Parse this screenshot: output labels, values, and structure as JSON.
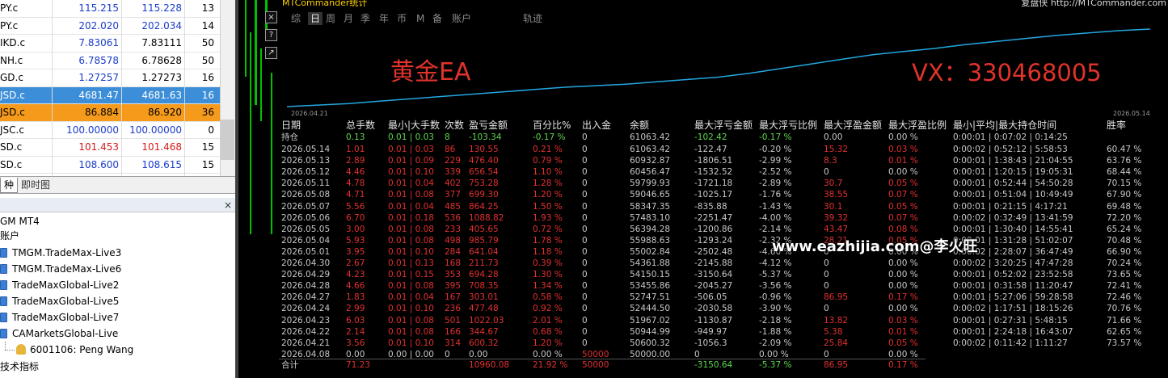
{
  "market_watch": {
    "rows": [
      {
        "symbol": "PY.c",
        "bid": "115.215",
        "ask": "115.228",
        "spread": "13",
        "bid_color": "#1a3cc8",
        "ask_color": "#1a3cc8",
        "bg": ""
      },
      {
        "symbol": "PY.c",
        "bid": "202.020",
        "ask": "202.034",
        "spread": "14",
        "bid_color": "#1a3cc8",
        "ask_color": "#1a3cc8",
        "bg": ""
      },
      {
        "symbol": "IKD.c",
        "bid": "7.83061",
        "ask": "7.83111",
        "spread": "50",
        "bid_color": "#1a3cc8",
        "ask_color": "#000000",
        "bg": ""
      },
      {
        "symbol": "NH.c",
        "bid": "6.78578",
        "ask": "6.78628",
        "spread": "50",
        "bid_color": "#1a3cc8",
        "ask_color": "#000000",
        "bg": ""
      },
      {
        "symbol": "GD.c",
        "bid": "1.27257",
        "ask": "1.27273",
        "spread": "16",
        "bid_color": "#1a3cc8",
        "ask_color": "#000000",
        "bg": ""
      },
      {
        "symbol": "JSD.c",
        "bid": "4681.47",
        "ask": "4681.63",
        "spread": "16",
        "bid_color": "#ffffff",
        "ask_color": "#ffffff",
        "bg": "#3c8ed8"
      },
      {
        "symbol": "JSD.c",
        "bid": "86.884",
        "ask": "86.920",
        "spread": "36",
        "bid_color": "#000000",
        "ask_color": "#000000",
        "bg": "#f59a1b"
      },
      {
        "symbol": "JSC.c",
        "bid": "100.00000",
        "ask": "100.00000",
        "spread": "0",
        "bid_color": "#1a3cc8",
        "ask_color": "#1a3cc8",
        "bg": ""
      },
      {
        "symbol": "SD.c",
        "bid": "101.453",
        "ask": "101.468",
        "spread": "15",
        "bid_color": "#d81818",
        "ask_color": "#d81818",
        "bg": ""
      },
      {
        "symbol": "SD.c",
        "bid": "108.600",
        "ask": "108.615",
        "spread": "15",
        "bid_color": "#1a3cc8",
        "ask_color": "#1a3cc8",
        "bg": ""
      }
    ],
    "tabs": [
      "种",
      "即时图"
    ]
  },
  "navigator": {
    "root": "GM MT4",
    "accounts_label": "账户",
    "accounts": [
      "TMGM.TradeMax-Live3",
      "TMGM.TradeMax-Live6",
      "TradeMaxGlobal-Live2",
      "TradeMaxGlobal-Live5",
      "TradeMaxGlobal-Live7",
      "CAMarketsGlobal-Live"
    ],
    "login": "6001106: Peng Wang",
    "indicators_label": "技术指标",
    "close_glyph": "×"
  },
  "stats_window": {
    "title": "MTCommander统计",
    "brand": "复盘侠 http://MTCommander.com",
    "toolbar": [
      "综",
      "日",
      "周",
      "月",
      "季",
      "年",
      "币",
      "M",
      "备",
      "账户",
      "轨迹"
    ],
    "active_tab": "日",
    "watermark_left": "黄金EA",
    "watermark_right": "VX：330468005",
    "overlay_text": "www.eazhijia.com@李火旺",
    "equity": {
      "start_label": "2026.04.21",
      "end_label": "2026.05.14",
      "line_color": "#23a7e0",
      "curve": [
        0,
        2,
        4,
        7,
        10,
        13,
        16,
        19,
        22,
        25,
        27,
        29,
        32,
        35,
        38,
        43,
        49,
        55,
        61,
        67,
        71,
        75,
        80,
        84,
        88,
        92,
        95,
        98,
        100
      ]
    },
    "headers": [
      "日期",
      "总手数",
      "最小|大手数",
      "次数",
      "盈亏金额",
      "百分比%",
      "出入金",
      "余额",
      "最大浮亏金额",
      "最大浮亏比例",
      "最大浮盈金额",
      "最大浮盈比例",
      "最小|平均|最大持仓时间",
      "胜率"
    ],
    "holding": {
      "label": "持仓",
      "lots": "0.13",
      "minmax": "0.01 | 0.03",
      "count": "8",
      "pnl": "-103.34",
      "pct": "-0.17 %",
      "io": "0",
      "balance": "61063.42",
      "fl": "-102.42",
      "flp": "-0.17 %",
      "fp": "0.00",
      "fpp": "0.00 %",
      "time": "0:00:01 | 0:07:02 | 0:14:25",
      "win": ""
    },
    "rows": [
      {
        "d": "2026.05.14",
        "lots": "1.01",
        "mm": "0.01 | 0.03",
        "n": "86",
        "pnl": "130.55",
        "pct": "0.21 %",
        "io": "0",
        "bal": "61063.42",
        "fl": "-122.47",
        "flp": "-0.20 %",
        "fp": "15.32",
        "fpp": "0.03 %",
        "time": "0:00:02 | 0:52:12 | 5:58:53",
        "win": "60.47 %"
      },
      {
        "d": "2026.05.13",
        "lots": "2.89",
        "mm": "0.01 | 0.09",
        "n": "229",
        "pnl": "476.40",
        "pct": "0.79 %",
        "io": "0",
        "bal": "60932.87",
        "fl": "-1806.51",
        "flp": "-2.99 %",
        "fp": "8.3",
        "fpp": "0.01 %",
        "time": "0:00:01 | 1:38:43 | 21:04:55",
        "win": "63.76 %"
      },
      {
        "d": "2026.05.12",
        "lots": "4.46",
        "mm": "0.01 | 0.10",
        "n": "339",
        "pnl": "656.54",
        "pct": "1.10 %",
        "io": "0",
        "bal": "60456.47",
        "fl": "-1532.52",
        "flp": "-2.52 %",
        "fp": "0",
        "fpp": "0.00 %",
        "time": "0:00:01 | 1:20:15 | 19:05:31",
        "win": "68.44 %"
      },
      {
        "d": "2026.05.11",
        "lots": "4.78",
        "mm": "0.01 | 0.04",
        "n": "402",
        "pnl": "753.28",
        "pct": "1.28 %",
        "io": "0",
        "bal": "59799.93",
        "fl": "-1721.18",
        "flp": "-2.89 %",
        "fp": "30.7",
        "fpp": "0.05 %",
        "time": "0:00:01 | 0:52:44 | 54:50:28",
        "win": "70.15 %"
      },
      {
        "d": "2026.05.08",
        "lots": "4.71",
        "mm": "0.01 | 0.08",
        "n": "377",
        "pnl": "699.30",
        "pct": "1.20 %",
        "io": "0",
        "bal": "59046.65",
        "fl": "-1025.17",
        "flp": "-1.76 %",
        "fp": "38.55",
        "fpp": "0.07 %",
        "time": "0:00:01 | 0:51:04 | 10:49:49",
        "win": "67.90 %"
      },
      {
        "d": "2026.05.07",
        "lots": "5.56",
        "mm": "0.01 | 0.04",
        "n": "485",
        "pnl": "864.25",
        "pct": "1.50 %",
        "io": "0",
        "bal": "58347.35",
        "fl": "-835.88",
        "flp": "-1.43 %",
        "fp": "30.1",
        "fpp": "0.05 %",
        "time": "0:00:01 | 0:21:15 | 4:17:21",
        "win": "69.48 %"
      },
      {
        "d": "2026.05.06",
        "lots": "6.70",
        "mm": "0.01 | 0.18",
        "n": "536",
        "pnl": "1088.82",
        "pct": "1.93 %",
        "io": "0",
        "bal": "57483.10",
        "fl": "-2251.47",
        "flp": "-4.00 %",
        "fp": "39.32",
        "fpp": "0.07 %",
        "time": "0:00:02 | 0:32:49 | 13:41:59",
        "win": "72.20 %"
      },
      {
        "d": "2026.05.05",
        "lots": "3.00",
        "mm": "0.01 | 0.08",
        "n": "233",
        "pnl": "405.65",
        "pct": "0.72 %",
        "io": "0",
        "bal": "56394.28",
        "fl": "-1200.86",
        "flp": "-2.14 %",
        "fp": "43.47",
        "fpp": "0.08 %",
        "time": "0:00:01 | 1:30:40 | 14:55:41",
        "win": "65.24 %"
      },
      {
        "d": "2026.05.04",
        "lots": "5.93",
        "mm": "0.01 | 0.08",
        "n": "498",
        "pnl": "985.79",
        "pct": "1.78 %",
        "io": "0",
        "bal": "55988.63",
        "fl": "-1293.24",
        "flp": "-2.32 %",
        "fp": "28.21",
        "fpp": "0.05 %",
        "time": "0:00:01 | 1:31:28 | 51:02:07",
        "win": "70.48 %"
      },
      {
        "d": "2026.05.01",
        "lots": "3.95",
        "mm": "0.01 | 0.10",
        "n": "284",
        "pnl": "641.04",
        "pct": "1.18 %",
        "io": "0",
        "bal": "55002.84",
        "fl": "-2502.48",
        "flp": "-4.60 %",
        "fp": "0",
        "fpp": "0.00 %",
        "time": "0:00:02 | 2:28:07 | 36:47:49",
        "win": "66.90 %"
      },
      {
        "d": "2026.04.30",
        "lots": "2.67",
        "mm": "0.01 | 0.13",
        "n": "168",
        "pnl": "211.73",
        "pct": "0.39 %",
        "io": "0",
        "bal": "54361.88",
        "fl": "-2145.88",
        "flp": "-4.12 %",
        "fp": "0",
        "fpp": "0.00 %",
        "time": "0:00:02 | 3:20:25 | 47:47:28",
        "win": "70.24 %"
      },
      {
        "d": "2026.04.29",
        "lots": "4.23",
        "mm": "0.01 | 0.15",
        "n": "353",
        "pnl": "694.28",
        "pct": "1.30 %",
        "io": "0",
        "bal": "54150.15",
        "fl": "-3150.64",
        "flp": "-5.37 %",
        "fp": "0",
        "fpp": "0.00 %",
        "time": "0:00:01 | 0:52:02 | 23:52:58",
        "win": "73.65 %"
      },
      {
        "d": "2026.04.28",
        "lots": "4.66",
        "mm": "0.01 | 0.08",
        "n": "395",
        "pnl": "708.35",
        "pct": "1.34 %",
        "io": "0",
        "bal": "53455.86",
        "fl": "-2045.27",
        "flp": "-3.56 %",
        "fp": "0",
        "fpp": "0.00 %",
        "time": "0:00:01 | 0:31:58 | 11:20:47",
        "win": "72.41 %"
      },
      {
        "d": "2026.04.27",
        "lots": "1.83",
        "mm": "0.01 | 0.04",
        "n": "167",
        "pnl": "303.01",
        "pct": "0.58 %",
        "io": "0",
        "bal": "52747.51",
        "fl": "-506.05",
        "flp": "-0.96 %",
        "fp": "86.95",
        "fpp": "0.17 %",
        "time": "0:00:01 | 5:27:06 | 59:28:58",
        "win": "72.46 %"
      },
      {
        "d": "2026.04.24",
        "lots": "2.99",
        "mm": "0.01 | 0.10",
        "n": "236",
        "pnl": "477.48",
        "pct": "0.92 %",
        "io": "0",
        "bal": "52444.50",
        "fl": "-2030.58",
        "flp": "-3.90 %",
        "fp": "0",
        "fpp": "0.00 %",
        "time": "0:00:02 | 1:17:51 | 18:15:26",
        "win": "70.76 %"
      },
      {
        "d": "2026.04.23",
        "lots": "6.03",
        "mm": "0.01 | 0.08",
        "n": "501",
        "pnl": "1022.03",
        "pct": "2.01 %",
        "io": "0",
        "bal": "51967.02",
        "fl": "-1130.87",
        "flp": "-2.18 %",
        "fp": "13.82",
        "fpp": "0.03 %",
        "time": "0:00:01 | 0:27:31 | 5:48:15",
        "win": "71.66 %"
      },
      {
        "d": "2026.04.22",
        "lots": "2.14",
        "mm": "0.01 | 0.08",
        "n": "166",
        "pnl": "344.67",
        "pct": "0.68 %",
        "io": "0",
        "bal": "50944.99",
        "fl": "-949.97",
        "flp": "-1.88 %",
        "fp": "5.38",
        "fpp": "0.01 %",
        "time": "0:00:01 | 2:24:18 | 16:43:07",
        "win": "62.65 %"
      },
      {
        "d": "2026.04.21",
        "lots": "3.56",
        "mm": "0.01 | 0.10",
        "n": "314",
        "pnl": "600.32",
        "pct": "1.20 %",
        "io": "0",
        "bal": "50600.32",
        "fl": "-1056.3",
        "flp": "-2.09 %",
        "fp": "25.84",
        "fpp": "0.05 %",
        "time": "0:00:02 | 0:11:42 | 1:11:27",
        "win": "73.57 %"
      },
      {
        "d": "2026.04.08",
        "lots": "0.00",
        "mm": "0.00 | 0.00",
        "n": "0",
        "pnl": "0.00",
        "pct": "0.00 %",
        "io": "50000",
        "bal": "50000.00",
        "fl": "0",
        "flp": "0.00 %",
        "fp": "0",
        "fpp": "0.00 %",
        "time": "",
        "win": ""
      }
    ],
    "total": {
      "label": "合计",
      "lots": "71.23",
      "pnl": "10960.08",
      "pct": "21.92 %",
      "io": "50000",
      "fl": "-3150.64",
      "flp": "-5.37 %",
      "fp": "86.95",
      "fpp": "0.17 %"
    }
  }
}
